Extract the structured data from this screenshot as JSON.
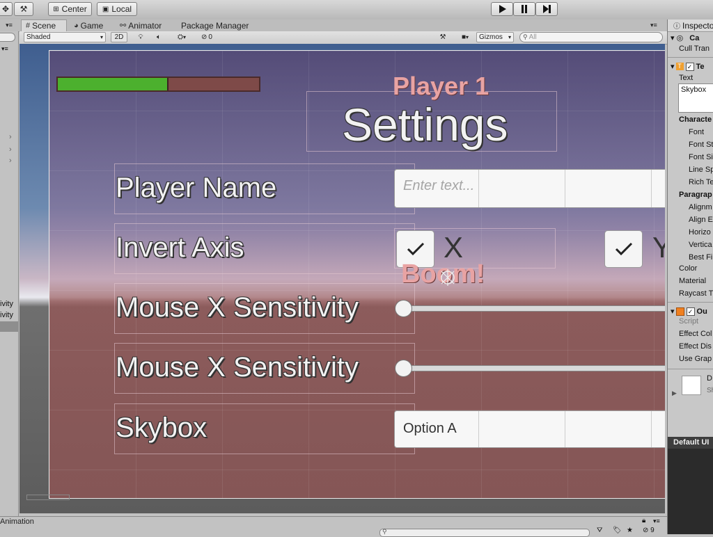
{
  "toolbar": {
    "center_label": "Center",
    "local_label": "Local"
  },
  "tabs": [
    {
      "label": "Scene",
      "icon": "grid-icon"
    },
    {
      "label": "Game",
      "icon": "pacman-icon"
    },
    {
      "label": "Animator",
      "icon": "animator-icon"
    },
    {
      "label": "Package Manager",
      "icon": ""
    }
  ],
  "scene_toolbar": {
    "shading_mode": "Shaded",
    "mode_2d": "2D",
    "hidden_count": "0",
    "gizmos_label": "Gizmos",
    "search_placeholder": "All"
  },
  "left_panel": {
    "item1": "ivity",
    "item2": "ivity"
  },
  "canvas": {
    "health_fill": 0.55,
    "player_label": "Player 1",
    "title": "Settings",
    "player_name_label": "Player Name",
    "player_name_placeholder": "Enter text...",
    "invert_axis_label": "Invert Axis",
    "axis_x_label": "X",
    "axis_y_label": "Y",
    "boom_label": "Boom!",
    "mouse_x_label_1": "Mouse X Sensitivity",
    "mouse_x_label_2": "Mouse X Sensitivity",
    "skybox_label": "Skybox",
    "skybox_option": "Option A"
  },
  "inspector": {
    "tab_label": "Inspecto",
    "camera_component": "Ca",
    "cull_label": "Cull Tran",
    "text_component": "Te",
    "text_label": "Text",
    "text_value": "Skybox",
    "character_header": "Characte",
    "font_label": "Font",
    "font_style_label": "Font St",
    "font_size_label": "Font Si",
    "line_spacing_label": "Line Sp",
    "rich_text_label": "Rich Te",
    "paragraph_header": "Paragrap",
    "alignment_label": "Alignm",
    "align_by_label": "Align E",
    "horizontal_label": "Horizo",
    "vertical_label": "Vertica",
    "best_fit_label": "Best Fi",
    "color_label": "Color",
    "material_label": "Material",
    "raycast_label": "Raycast T",
    "outline_component": "Ou",
    "script_label": "Script",
    "effect_color_label": "Effect Col",
    "effect_distance_label": "Effect Dis",
    "use_graphic_label": "Use Grap",
    "material_name": "D",
    "shader_label": "Sh",
    "default_ui_label": "Default UI"
  },
  "bottom": {
    "animation_label": "Animation",
    "layer_count": "9"
  },
  "colors": {
    "health_green": "#4cb02e",
    "health_track": "#7e4a48"
  }
}
